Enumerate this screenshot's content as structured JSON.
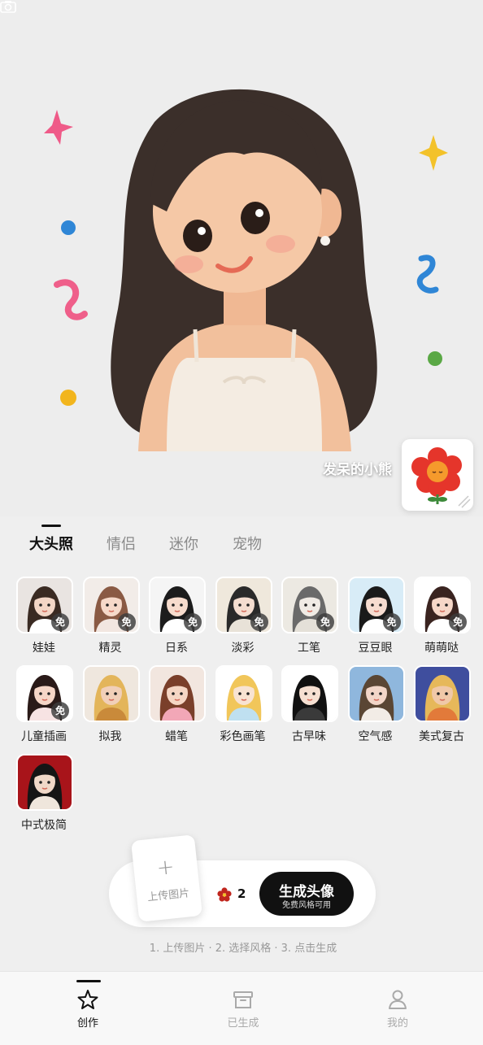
{
  "hero": {
    "name": "发呆的小熊"
  },
  "category_tabs": [
    {
      "label": "大头照",
      "active": true
    },
    {
      "label": "情侣",
      "active": false
    },
    {
      "label": "迷你",
      "active": false
    },
    {
      "label": "宠物",
      "active": false
    }
  ],
  "free_badge": "免",
  "styles": [
    {
      "label": "娃娃",
      "free": true,
      "bg": "#e9e4e1",
      "hair": "#3a2a22",
      "skin": "#f3d6c6",
      "cloth": "#ffffff"
    },
    {
      "label": "精灵",
      "free": true,
      "bg": "#f2ece8",
      "hair": "#8a5a44",
      "skin": "#f6d9c9",
      "cloth": "#f2e6e0"
    },
    {
      "label": "日系",
      "free": true,
      "bg": "#f5f5f5",
      "hair": "#1c1c1c",
      "skin": "#f7dccd",
      "cloth": "#ffffff"
    },
    {
      "label": "淡彩",
      "free": true,
      "bg": "#efe8dc",
      "hair": "#2a2a2a",
      "skin": "#f4ddd0",
      "cloth": "#e8e2d8"
    },
    {
      "label": "工笔",
      "free": true,
      "bg": "#ece9e2",
      "hair": "#6a6a6a",
      "skin": "#f0ebe5",
      "cloth": "#e4e0d8"
    },
    {
      "label": "豆豆眼",
      "free": true,
      "bg": "#d8ecf7",
      "hair": "#1a1a1a",
      "skin": "#f6dcd0",
      "cloth": "#ffffff"
    },
    {
      "label": "萌萌哒",
      "free": true,
      "bg": "#ffffff",
      "hair": "#3a2420",
      "skin": "#f6d7c8",
      "cloth": "#ffffff"
    },
    {
      "label": "儿童插画",
      "free": true,
      "bg": "#ffffff",
      "hair": "#2a1a18",
      "skin": "#f6d6c7",
      "cloth": "#f7e3e3"
    },
    {
      "label": "拟我",
      "free": false,
      "bg": "#efe7de",
      "hair": "#e3b55a",
      "skin": "#f1cfb8",
      "cloth": "#c98a3a"
    },
    {
      "label": "蜡笔",
      "free": false,
      "bg": "#f2e6df",
      "hair": "#7a3f2a",
      "skin": "#f5d6c4",
      "cloth": "#f2a7b7"
    },
    {
      "label": "彩色画笔",
      "free": false,
      "bg": "#ffffff",
      "hair": "#f1c65a",
      "skin": "#f8e3d2",
      "cloth": "#bfe0f0"
    },
    {
      "label": "古早味",
      "free": false,
      "bg": "#ffffff",
      "hair": "#111111",
      "skin": "#f6e0d2",
      "cloth": "#3a3a3a"
    },
    {
      "label": "空气感",
      "free": false,
      "bg": "#8fb7dd",
      "hair": "#5a4634",
      "skin": "#f2d6c8",
      "cloth": "#f2ece6"
    },
    {
      "label": "美式复古",
      "free": false,
      "bg": "#3f4e9e",
      "hair": "#e6b85a",
      "skin": "#f0c8a8",
      "cloth": "#e27a3a"
    },
    {
      "label": "中式极简",
      "free": false,
      "bg": "#a8141a",
      "hair": "#151515",
      "skin": "#f0d8c8",
      "cloth": "#efe6dc"
    }
  ],
  "upload": {
    "label": "上传图片",
    "plus": "+"
  },
  "coins": {
    "count": "2"
  },
  "generate": {
    "title": "生成头像",
    "subtitle": "免费风格可用"
  },
  "steps_text": "1. 上传图片 · 2. 选择风格 · 3. 点击生成",
  "nav": [
    {
      "label": "创作",
      "icon": "star-icon",
      "active": true
    },
    {
      "label": "已生成",
      "icon": "archive-box-icon",
      "active": false
    },
    {
      "label": "我的",
      "icon": "person-icon",
      "active": false
    }
  ],
  "colors": {
    "accent": "#111111",
    "coin_red": "#c0261e"
  }
}
